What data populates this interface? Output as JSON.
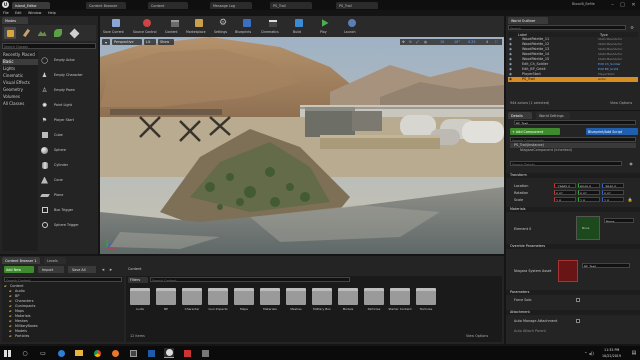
{
  "title_bar": {
    "tabs": [
      "Island_Editor",
      "Content Browser",
      "Content",
      "Message Log",
      "PS_Trail",
      "PS_Trail"
    ],
    "project_name": "Blood8_BeMe",
    "menu": [
      "File",
      "Edit",
      "Window",
      "Help"
    ]
  },
  "modes": {
    "tab": "Modes",
    "search_placeholder": "Search Classes",
    "categories": [
      "Recently Placed",
      "Basic",
      "Lights",
      "Cinematic",
      "Visual Effects",
      "Geometry",
      "Volumes",
      "All Classes"
    ],
    "active_category": "Basic",
    "items": [
      "Empty Actor",
      "Empty Character",
      "Empty Pawn",
      "Point Light",
      "Player Start",
      "Cube",
      "Sphere",
      "Cylinder",
      "Cone",
      "Plane",
      "Box Trigger",
      "Sphere Trigger"
    ]
  },
  "toolbar": {
    "items": [
      "Save Current",
      "Source Control",
      "Content",
      "Marketplace",
      "Settings",
      "Blueprints",
      "Cinematics",
      "Build",
      "Play",
      "Launch"
    ]
  },
  "viewport": {
    "mode_label": "Perspective",
    "lit_label": "Lit",
    "show_label": "Show",
    "grid_value": "10",
    "angle_value": "10°",
    "scale_value": "0.25",
    "speed_value": "4"
  },
  "world_outliner": {
    "tab": "World Outliner",
    "search_placeholder": "Search...",
    "col_label": "Label",
    "col_type": "Type",
    "rows": [
      {
        "label": "WoodPalette_11",
        "type": "StaticMeshActor"
      },
      {
        "label": "WoodPalette_12",
        "type": "StaticMeshActor"
      },
      {
        "label": "WoodPalette_13",
        "type": "StaticMeshActor"
      },
      {
        "label": "WoodPalette_14",
        "type": "StaticMeshActor"
      },
      {
        "label": "WoodPalette_15",
        "type": "StaticMeshActor"
      },
      {
        "label": "Edit_Ch_Soldier",
        "type": "Edit Ch_Soldier"
      },
      {
        "label": "Edit_BP_Grid4",
        "type": "Edit BP_Grid4"
      },
      {
        "label": "PlayerStart",
        "type": "PlayerStart"
      },
      {
        "label": "PS_Trail",
        "type": "Actor"
      }
    ],
    "footer": "944 actors (1 selected)",
    "view_options": "View Options"
  },
  "details": {
    "tabs": [
      "Details",
      "World Settings"
    ],
    "actor_name": "PS_Trail",
    "add_component": "+ Add Component",
    "blueprint": "Blueprint/Add Script",
    "search_placeholder": "Search Components",
    "components": [
      "PS_Trail(Instance)",
      "NiagaraComponent (Inherited)"
    ],
    "search_details": "Search Details",
    "transform_header": "Transform",
    "location_label": "Location",
    "rotation_label": "Rotation",
    "scale_label": "Scale",
    "location": [
      "-13665.0",
      "6040.0",
      "-3840.0"
    ],
    "rotation": [
      "0.0°",
      "0.0°",
      "0.0°"
    ],
    "scale": [
      "1.0",
      "1.0",
      "1.0"
    ],
    "materials_header": "Materials",
    "element_label": "Element 0",
    "material_name": "None",
    "override_params": "Override Parameters",
    "niagara_label": "Niagara System Asset",
    "niagara_value": "PS_Trail",
    "parameters_header": "Parameters",
    "force_solo": "Force Solo",
    "attachment_header": "Attachment",
    "auto_manage": "Auto Manage Attachment",
    "auto_attach": "Auto Attach Parent"
  },
  "content_browser": {
    "tabs": [
      "Content Browser 1",
      "Levels"
    ],
    "add_new": "Add New",
    "import": "Import",
    "save_all": "Save All",
    "path": "Content",
    "filters": "Filters",
    "search_placeholder": "Search Content",
    "tree_root": "Content",
    "tree": [
      "Audio",
      "BP",
      "Characters",
      "Gunimpacts",
      "Maps",
      "Materials",
      "Meshes",
      "MilitaryBoxes",
      "Models",
      "Particles"
    ],
    "folders": [
      "Audio",
      "BP",
      "Character",
      "Gun Impacts",
      "Maps",
      "Materials",
      "Meshes",
      "Military Box",
      "Models",
      "Particles",
      "Starter Content",
      "Textures"
    ],
    "item_count": "12 items",
    "view_options": "View Options"
  },
  "taskbar": {
    "time": "11:35 PM",
    "date": "10/22/2019"
  }
}
